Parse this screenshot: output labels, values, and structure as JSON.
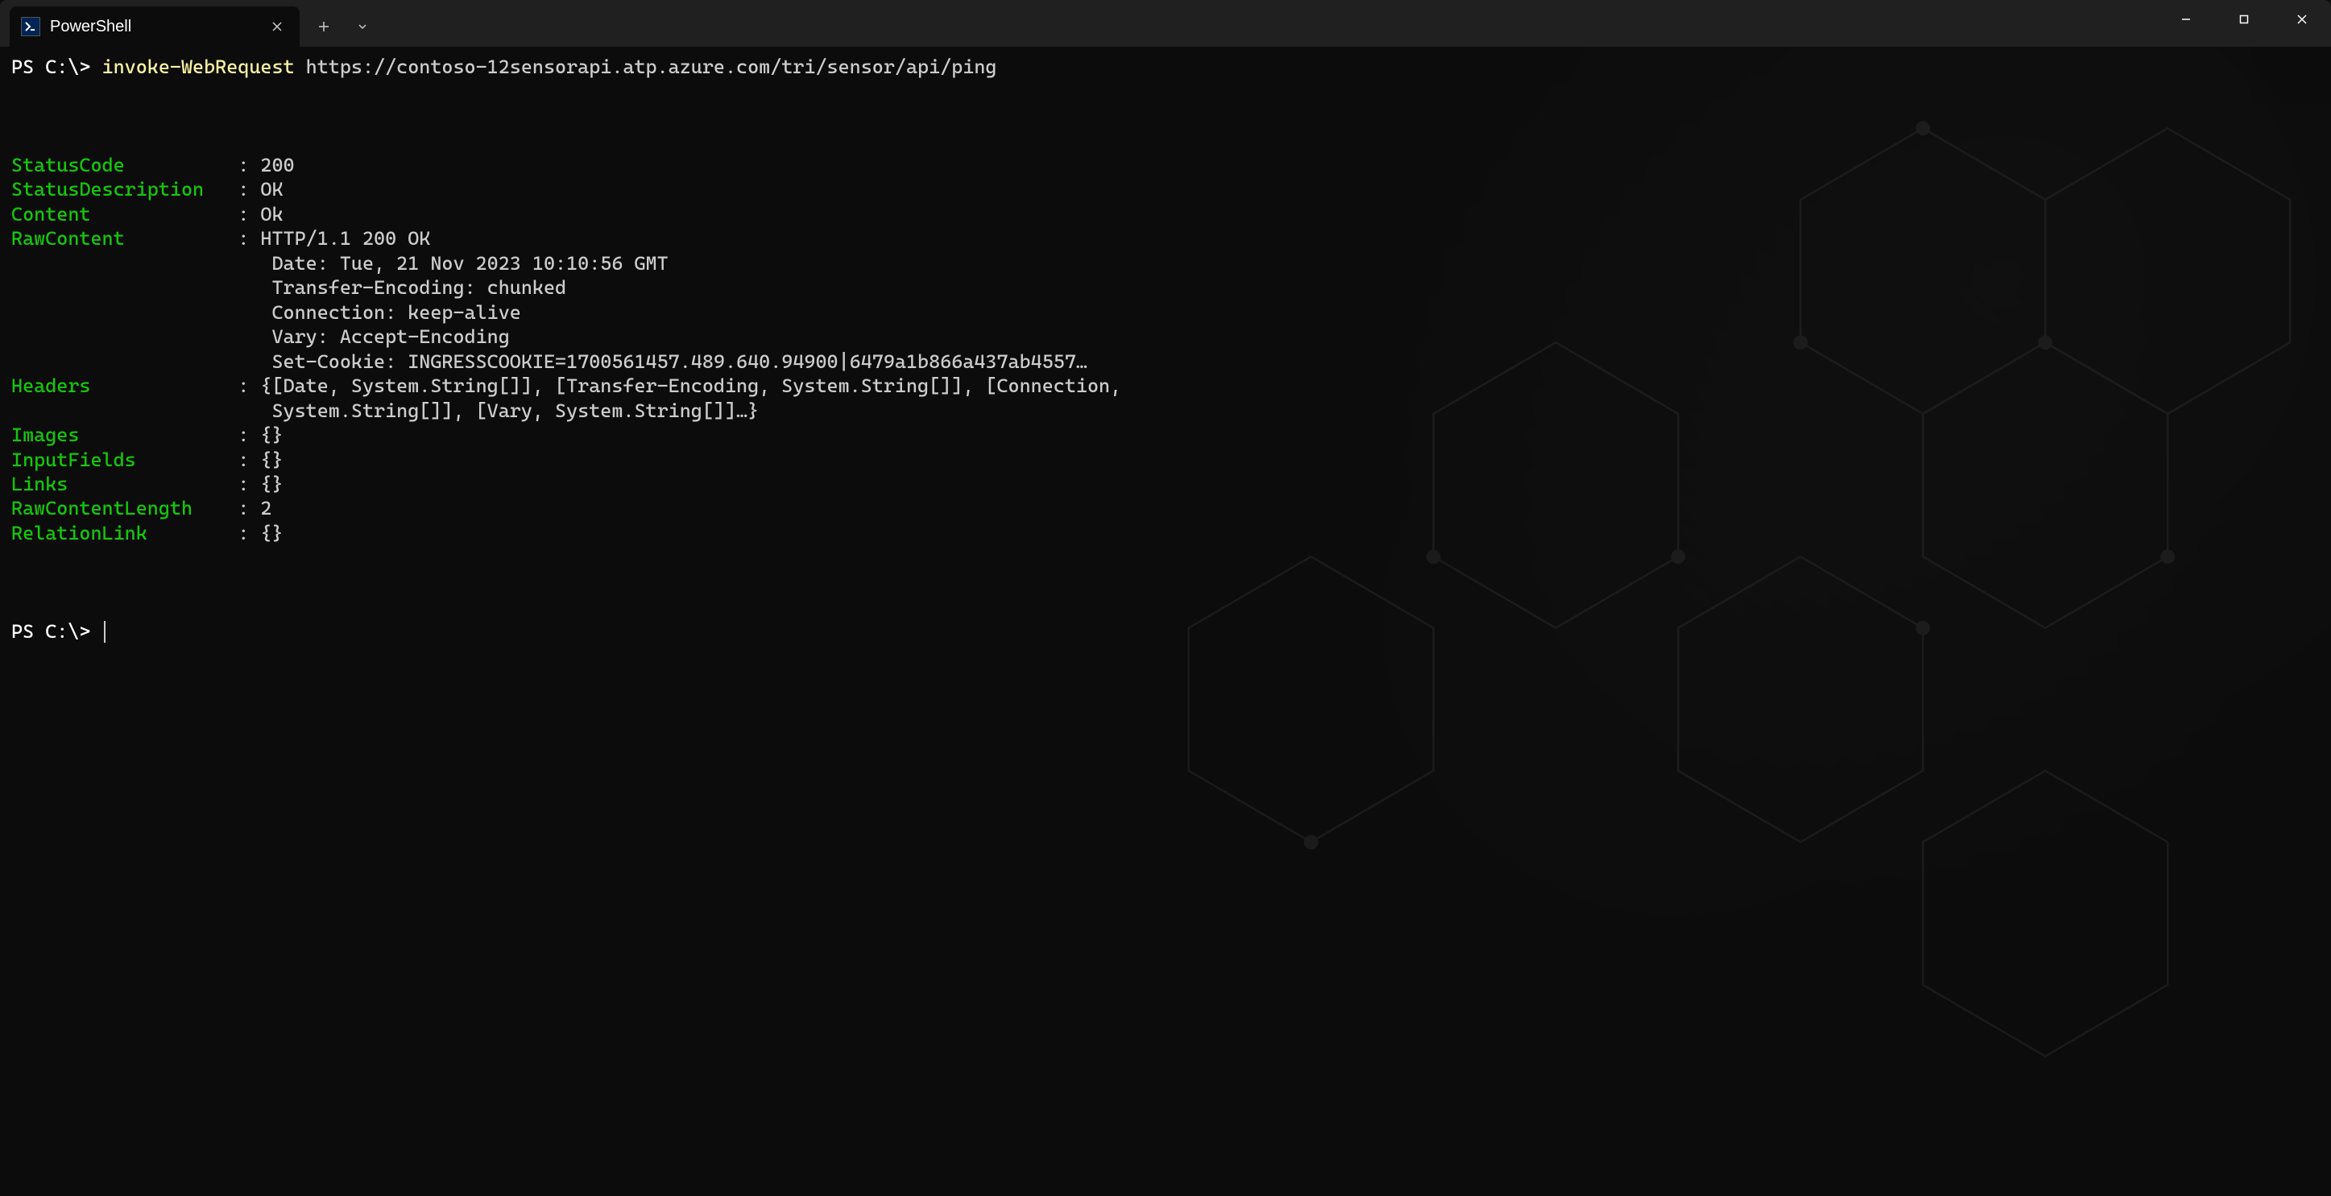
{
  "titlebar": {
    "tab_title": "PowerShell",
    "new_tab_glyph": "＋",
    "dropdown_glyph": "⌄",
    "close_glyph": "✕"
  },
  "terminal": {
    "prompt1": "PS C:\\>",
    "command_name": "invoke-WebRequest",
    "command_arg": "https://contoso-12sensorapi.atp.azure.com/tri/sensor/api/ping",
    "output": [
      {
        "key": "StatusCode",
        "value": "200"
      },
      {
        "key": "StatusDescription",
        "value": "OK"
      },
      {
        "key": "Content",
        "value": "Ok"
      },
      {
        "key": "RawContent",
        "value": "HTTP/1.1 200 OK",
        "cont": [
          "Date: Tue, 21 Nov 2023 10:10:56 GMT",
          "Transfer-Encoding: chunked",
          "Connection: keep-alive",
          "Vary: Accept-Encoding",
          "Set-Cookie: INGRESSCOOKIE=1700561457.489.640.94900|6479a1b866a437ab4557…"
        ]
      },
      {
        "key": "Headers",
        "value": "{[Date, System.String[]], [Transfer-Encoding, System.String[]], [Connection,",
        "cont": [
          "System.String[]], [Vary, System.String[]]…}"
        ]
      },
      {
        "key": "Images",
        "value": "{}"
      },
      {
        "key": "InputFields",
        "value": "{}"
      },
      {
        "key": "Links",
        "value": "{}"
      },
      {
        "key": "RawContentLength",
        "value": "2"
      },
      {
        "key": "RelationLink",
        "value": "{}"
      }
    ],
    "prompt2": "PS C:\\>"
  }
}
